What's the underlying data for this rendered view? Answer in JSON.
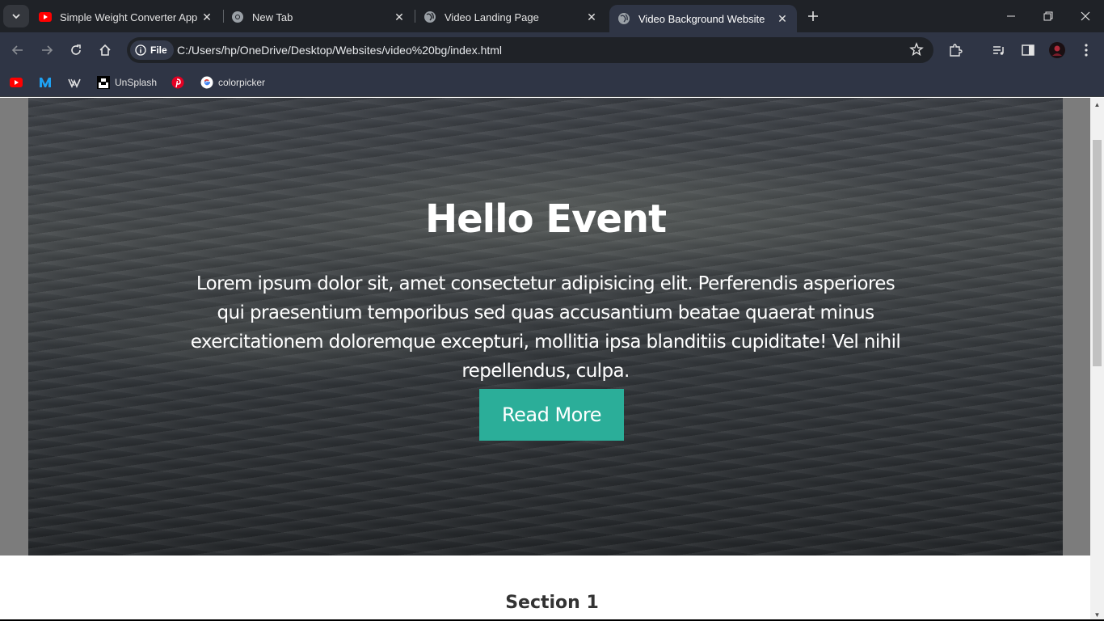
{
  "browser": {
    "tabs": [
      {
        "title": "Simple Weight Converter App V",
        "favicon": "youtube-icon"
      },
      {
        "title": "New Tab",
        "favicon": "chrome-icon"
      },
      {
        "title": "Video Landing Page",
        "favicon": "globe-icon"
      },
      {
        "title": "Video Background Website",
        "favicon": "globe-icon",
        "active": true
      }
    ],
    "address": {
      "chip_label": "File",
      "url": "C:/Users/hp/OneDrive/Desktop/Websites/video%20bg/index.html"
    },
    "bookmarks": [
      {
        "label": "",
        "icon": "youtube-icon"
      },
      {
        "label": "",
        "icon": "medium-icon"
      },
      {
        "label": "",
        "icon": "webflow-icon"
      },
      {
        "label": "UnSplash",
        "icon": "unsplash-icon"
      },
      {
        "label": "",
        "icon": "pinterest-icon"
      },
      {
        "label": "colorpicker",
        "icon": "google-icon"
      }
    ]
  },
  "page": {
    "hero": {
      "title": "Hello Event",
      "text": "Lorem ipsum dolor sit, amet consectetur adipisicing elit. Perferendis asperiores qui praesentium temporibus sed quas accusantium beatae quaerat minus exercitationem doloremque excepturi, mollitia ipsa blanditiis cupiditate! Vel nihil repellendus, culpa.",
      "button_label": "Read More"
    },
    "section1_title": "Section 1"
  },
  "colors": {
    "accent": "#2bae99",
    "chrome_frame": "#1f2227",
    "chrome_toolbar": "#2f3545"
  }
}
